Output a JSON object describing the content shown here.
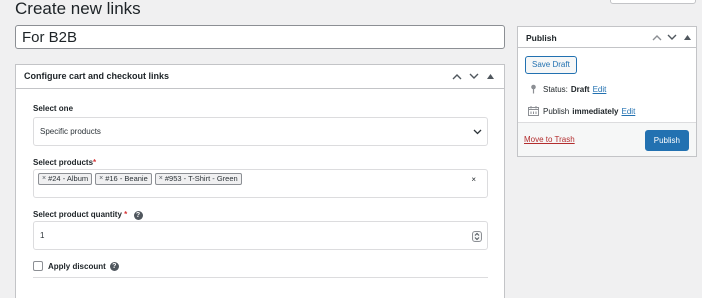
{
  "page": {
    "title": "Create new links",
    "post_title_value": "For B2B"
  },
  "config_box": {
    "title": "Configure cart and checkout links",
    "select_one": {
      "label": "Select one",
      "value": "Specific products"
    },
    "select_products": {
      "label": "Select products",
      "required_mark": "*",
      "chips": [
        {
          "remove": "×",
          "label": "#24 - Album"
        },
        {
          "remove": "×",
          "label": "#16 - Beanie"
        },
        {
          "remove": "×",
          "label": "#953 - T-Shirt - Green"
        }
      ],
      "clear": "×"
    },
    "quantity": {
      "label": "Select product quantity",
      "required_mark": "*",
      "help": "?",
      "value": "1"
    },
    "apply_discount": {
      "label": "Apply discount",
      "help": "?",
      "checked": false
    }
  },
  "publish_box": {
    "title": "Publish",
    "save_draft": "Save Draft",
    "status_label": "Status:",
    "status_value": "Draft",
    "status_edit": "Edit",
    "publish_label": "Publish",
    "publish_value": "immediately",
    "publish_edit": "Edit",
    "trash_link": "Move to Trash",
    "publish_button": "Publish"
  },
  "colors": {
    "accent": "#2271b1",
    "danger": "#b32d2e",
    "required": "#d63638",
    "background": "#f0f0f1"
  },
  "icons": [
    "chevron-up-icon",
    "chevron-down-icon",
    "triangle-up-icon",
    "pin-icon",
    "calendar-icon",
    "help-icon",
    "select-chevron-icon",
    "spinner-arrows-icon"
  ]
}
